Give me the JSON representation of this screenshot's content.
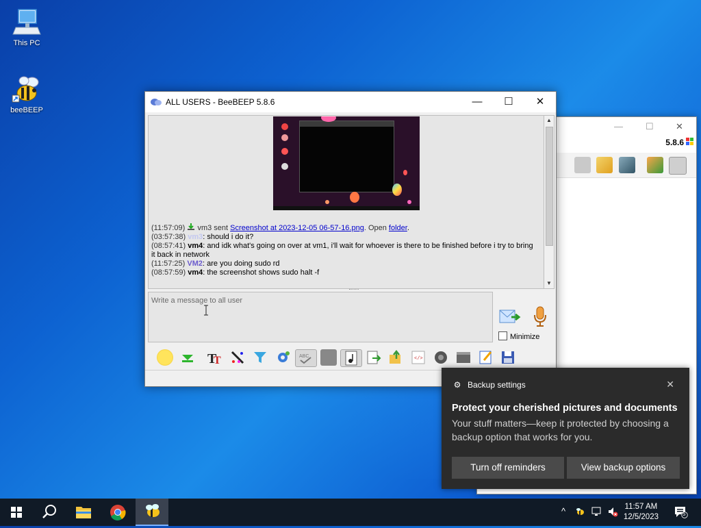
{
  "desktop": {
    "icons": [
      {
        "label": "This PC"
      },
      {
        "label": "beeBEEP"
      }
    ]
  },
  "back_window": {
    "version": "5.8.6"
  },
  "main_window": {
    "title": "ALL USERS - BeeBEEP 5.8.6",
    "messages": [
      {
        "time": "(11:57:09)",
        "pre": " vm3 sent ",
        "link": "Screenshot at 2023-12-05 06-57-16.png",
        "mid": ". Open ",
        "link2": "folder",
        "post": "."
      },
      {
        "time": "(03:57:38)",
        "user": "vm3",
        "text": ": should i do it?"
      },
      {
        "time": "(08:57:41)",
        "user": "vm4",
        "text": ": and idk what's going on over at vm1,   i'll wait for whoever is there to be finished before i try to bring it back in network"
      },
      {
        "time": "(11:57:25)",
        "user": "VM2",
        "text": ": are you doing sudo rd"
      },
      {
        "time": "(08:57:59)",
        "user": "vm4",
        "text": ": the screenshot shows sudo halt -f"
      }
    ],
    "input_placeholder": "Write a message to all user",
    "minimize_label": "Minimize"
  },
  "notification": {
    "app": "Backup settings",
    "heading": "Protect your cherished pictures and documents",
    "body": "Your stuff matters—keep it protected by choosing a backup option that works for you.",
    "btn_off": "Turn off reminders",
    "btn_view": "View backup options"
  },
  "taskbar": {
    "time": "11:57 AM",
    "date": "12/5/2023",
    "notif_count": "5"
  },
  "colors": {
    "accent": "#0078d7",
    "toast_bg": "#2b2b2b",
    "taskbar_bg": "#101a26"
  }
}
